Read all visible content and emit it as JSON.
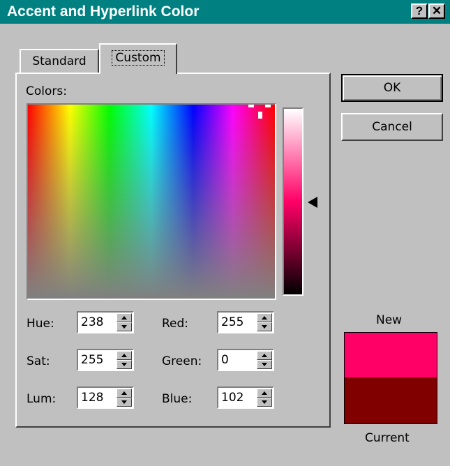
{
  "window": {
    "title": "Accent and Hyperlink Color"
  },
  "titlebar_buttons": {
    "help": "?",
    "close": "✕"
  },
  "tabs": [
    {
      "label": "Standard"
    },
    {
      "label": "Custom"
    }
  ],
  "colors_label": "Colors:",
  "buttons": {
    "ok": "OK",
    "cancel": "Cancel"
  },
  "fields": {
    "hue": {
      "label": "Hue:",
      "value": "238"
    },
    "sat": {
      "label": "Sat:",
      "value": "255"
    },
    "lum": {
      "label": "Lum:",
      "value": "128"
    },
    "red": {
      "label": "Red:",
      "value": "255"
    },
    "green": {
      "label": "Green:",
      "value": "0"
    },
    "blue": {
      "label": "Blue:",
      "value": "102"
    }
  },
  "preview": {
    "new_label": "New",
    "current_label": "Current",
    "new_color": "#ff0066",
    "current_color": "#800000"
  },
  "accent_colors": {
    "titlebar": "#008080",
    "face": "#c0c0c0"
  }
}
